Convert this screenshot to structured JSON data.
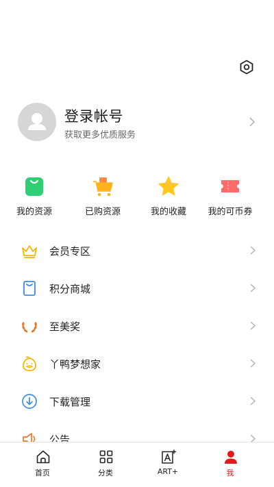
{
  "colors": {
    "accent": "#e21a1a",
    "green": "#2fcf73",
    "orange": "#ffb21a",
    "gold": "#ffc81a",
    "coupon": "#ff6b6b",
    "blue": "#3d8be6",
    "bronze": "#e8792a"
  },
  "header": {
    "settings_icon": "settings-icon"
  },
  "profile": {
    "title": "登录帐号",
    "subtitle": "获取更多优质服务"
  },
  "shortcuts": [
    {
      "label": "我的资源",
      "icon": "bag-icon"
    },
    {
      "label": "已购资源",
      "icon": "cart-icon"
    },
    {
      "label": "我的收藏",
      "icon": "star-icon"
    },
    {
      "label": "我的可币券",
      "icon": "ticket-icon"
    }
  ],
  "menu": [
    {
      "label": "会员专区",
      "icon": "crown-icon"
    },
    {
      "label": "积分商城",
      "icon": "shopping-bag-icon"
    },
    {
      "label": "至美奖",
      "icon": "laurel-icon"
    },
    {
      "label": "丫鸭梦想家",
      "icon": "duck-icon"
    },
    {
      "label": "下载管理",
      "icon": "download-icon"
    },
    {
      "label": "公告",
      "icon": "speaker-icon"
    }
  ],
  "bottom_nav": [
    {
      "label": "首页",
      "icon": "home-icon"
    },
    {
      "label": "分类",
      "icon": "grid-icon"
    },
    {
      "label": "ART+",
      "icon": "art-plus-icon"
    },
    {
      "label": "我",
      "icon": "person-icon",
      "active": true
    }
  ]
}
